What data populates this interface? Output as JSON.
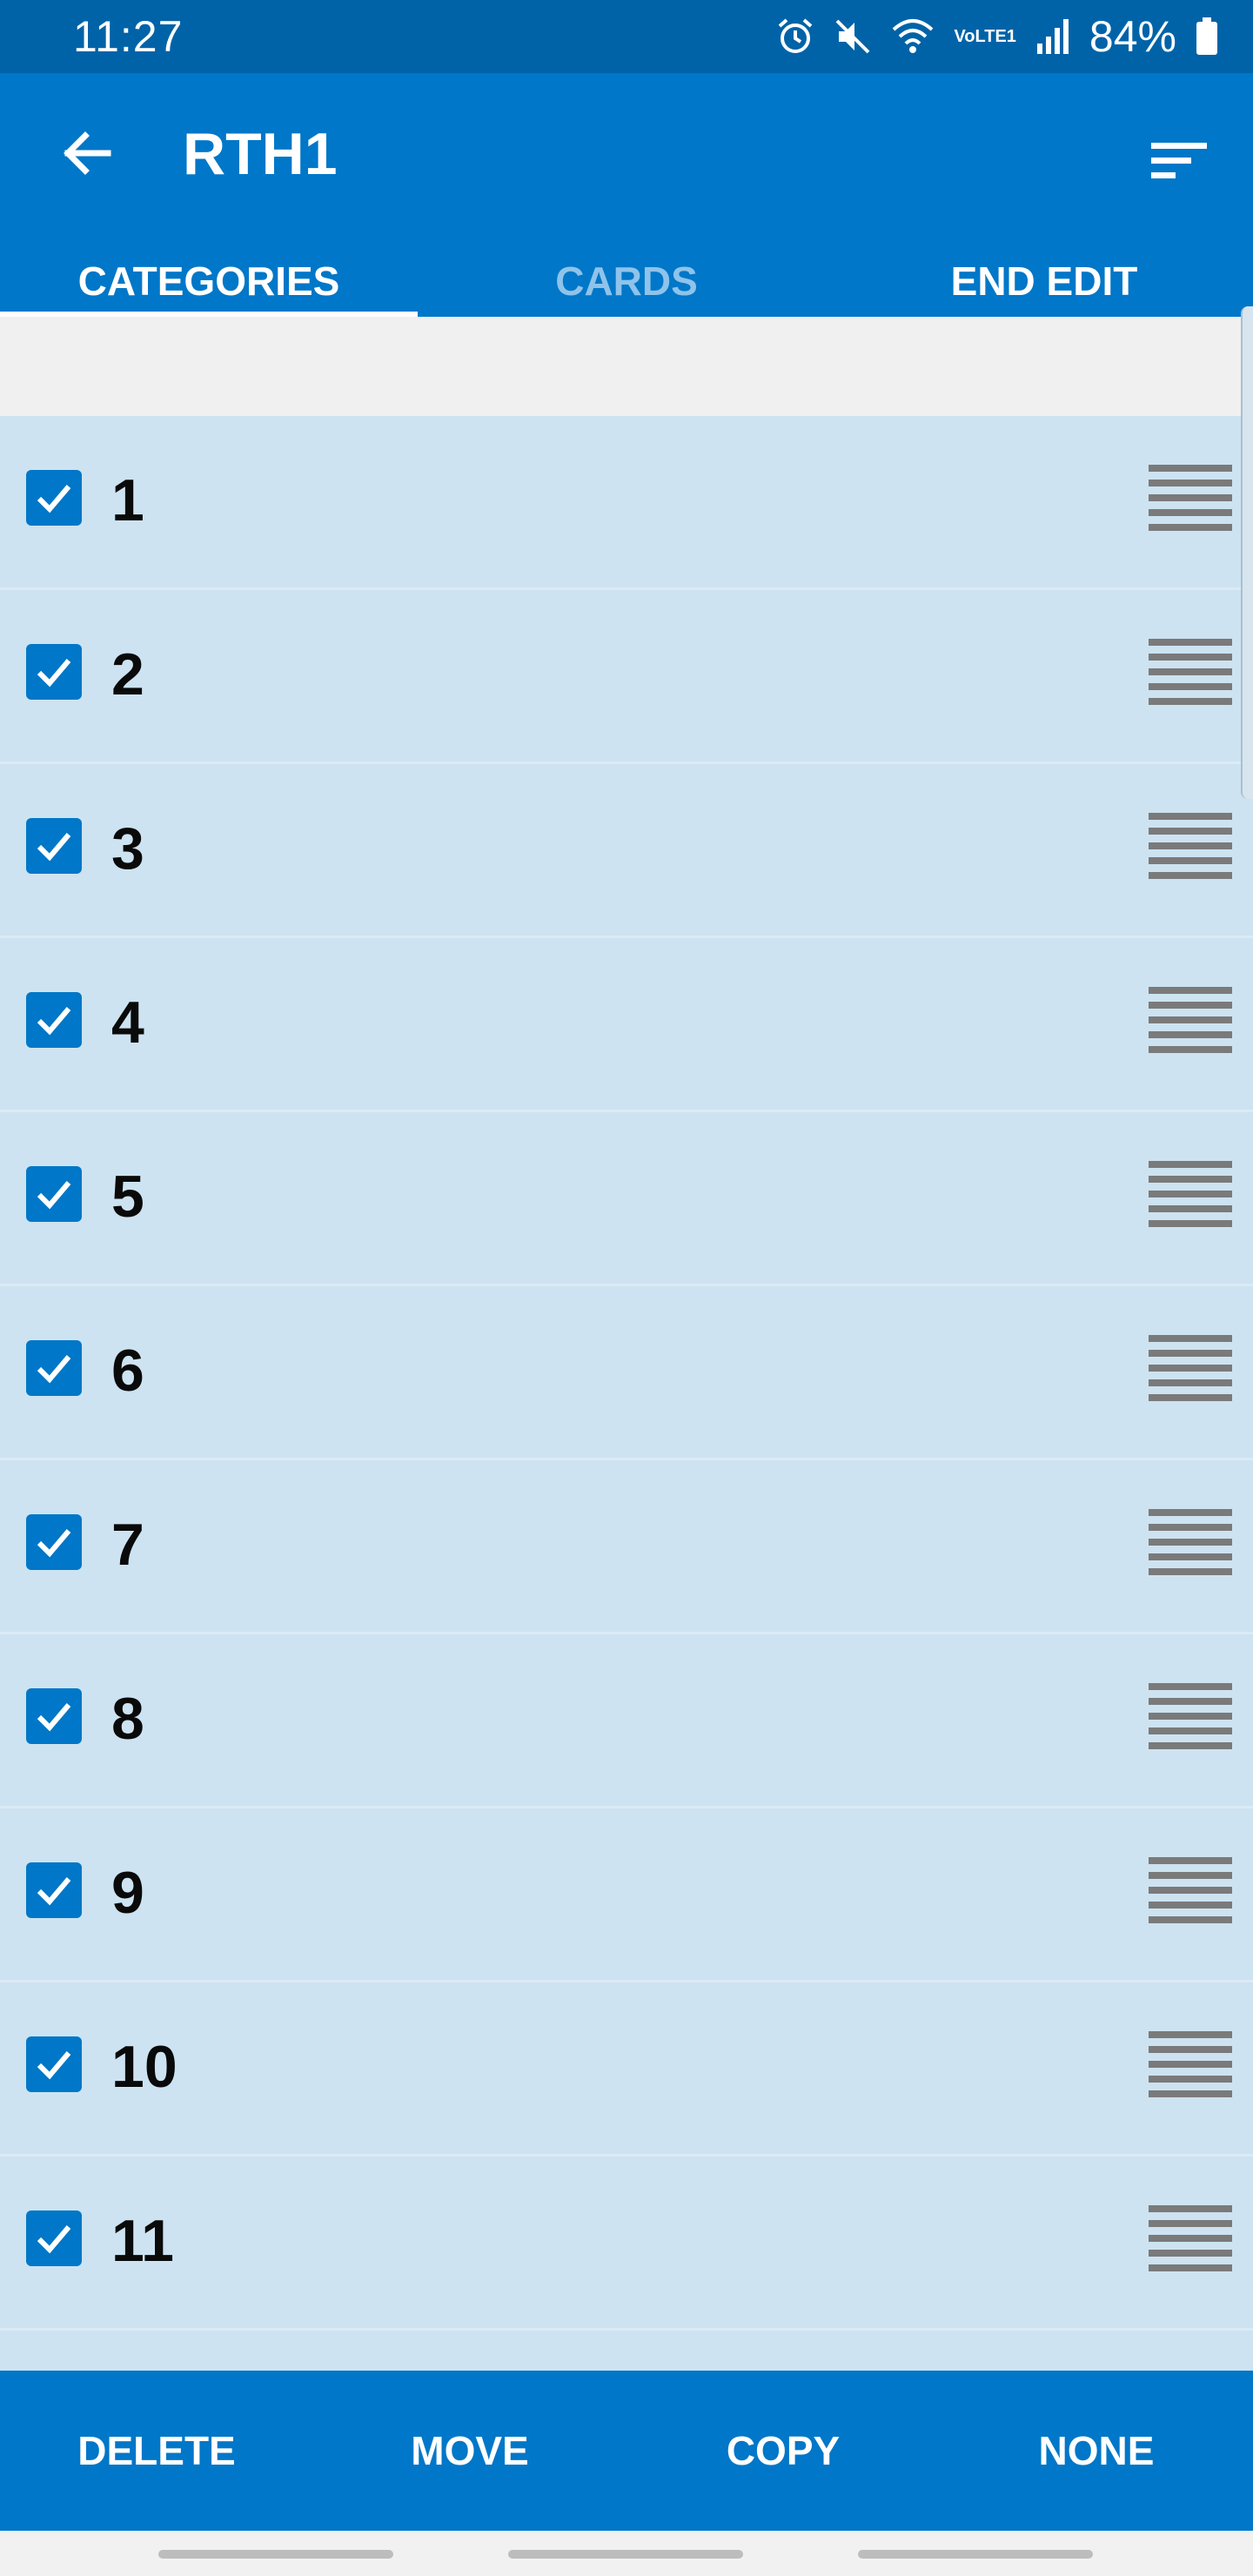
{
  "status_bar": {
    "time": "11:27",
    "network_label": "VoLTE1",
    "battery": "84%",
    "icons": [
      "alarm-icon",
      "mute-icon",
      "wifi-icon",
      "signal-icon",
      "battery-icon"
    ]
  },
  "app_bar": {
    "title": "RTH1",
    "back_icon": "arrow-left-icon",
    "sort_icon": "sort-icon"
  },
  "tabs": [
    {
      "label": "CATEGORIES",
      "active": true
    },
    {
      "label": "CARDS",
      "active": false
    },
    {
      "label": "END EDIT",
      "active": false
    }
  ],
  "categories": [
    {
      "label": "1",
      "checked": true
    },
    {
      "label": "2",
      "checked": true
    },
    {
      "label": "3",
      "checked": true
    },
    {
      "label": "4",
      "checked": true
    },
    {
      "label": "5",
      "checked": true
    },
    {
      "label": "6",
      "checked": true
    },
    {
      "label": "7",
      "checked": true
    },
    {
      "label": "8",
      "checked": true
    },
    {
      "label": "9",
      "checked": true
    },
    {
      "label": "10",
      "checked": true
    },
    {
      "label": "11",
      "checked": true
    }
  ],
  "actions": [
    {
      "label": "DELETE"
    },
    {
      "label": "MOVE"
    },
    {
      "label": "COPY"
    },
    {
      "label": "NONE"
    }
  ],
  "colors": {
    "primary": "#0077c8",
    "status_bar": "#0063a8",
    "list_background": "#cde3f1",
    "tab_inactive": "#8fc3ea",
    "drag_handle": "#7a7a7a"
  }
}
